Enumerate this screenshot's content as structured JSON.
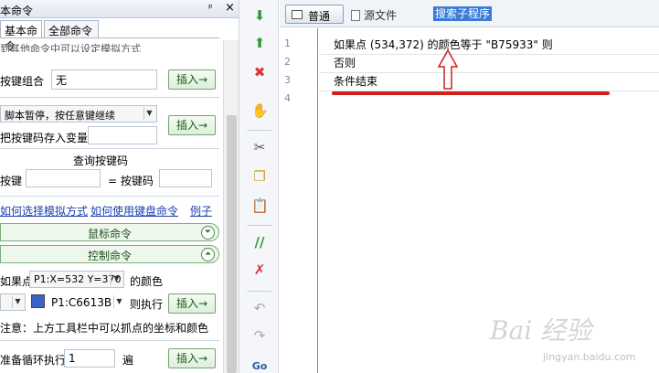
{
  "panel": {
    "title": "本命令",
    "pin_glyph": "ᵖ",
    "close_glyph": "×",
    "tabs": [
      "基本命令",
      "全部命令"
    ]
  },
  "form": {
    "truncated_hint": "到其他命令中可以设定模拟方式",
    "key_combo_label": "按键组合",
    "key_combo_value": "无",
    "insert_label": "插入→",
    "pause_select": "脚本暂停，按任意键继续",
    "save_key_label": "把按键码存入变量",
    "query_title": "查询按键码",
    "key_label": "按键",
    "keycode_label": "= 按键码",
    "link_choose": "如何选择模拟方式",
    "link_keyboard": "如何使用键盘命令",
    "link_example": "例子"
  },
  "sections": {
    "mouse": "鼠标命令",
    "control": "控制命令",
    "chev_down": "⏷",
    "chev_up": "⏶"
  },
  "control": {
    "if_point_label": "如果点",
    "point_select": "P1:X=532 Y=370",
    "color_of_label": "的颜色",
    "color_select": "P1:C6613B",
    "color_swatch": "#3a62c9",
    "then_label": "则执行",
    "note": "注意：上方工具栏中可以抓点的坐标和颜色",
    "loop_label": "准备循环执行",
    "loop_count": "1",
    "times_label": "遍"
  },
  "editor": {
    "mode_normal": "普通",
    "mode_source": "源文件",
    "search_sub": "搜索子程序",
    "line_numbers": [
      "1",
      "2",
      "3",
      "4"
    ],
    "lines": [
      "如果点 (534,372) 的颜色等于 \"B75933\" 则",
      "否则",
      "条件结束",
      ""
    ]
  },
  "toolbar_icons": [
    "arrow-down-icon",
    "arrow-up-icon",
    "delete-icon",
    "hand-icon",
    "cut-icon",
    "copy-icon",
    "paste-icon",
    "comment-icon",
    "uncomment-icon",
    "undo-icon",
    "redo-icon",
    "goto-icon"
  ],
  "toolbar_glyphs": {
    "goto": "Go"
  },
  "watermark": {
    "logo": "Bai 经验",
    "url": "jingyan.baidu.com"
  }
}
